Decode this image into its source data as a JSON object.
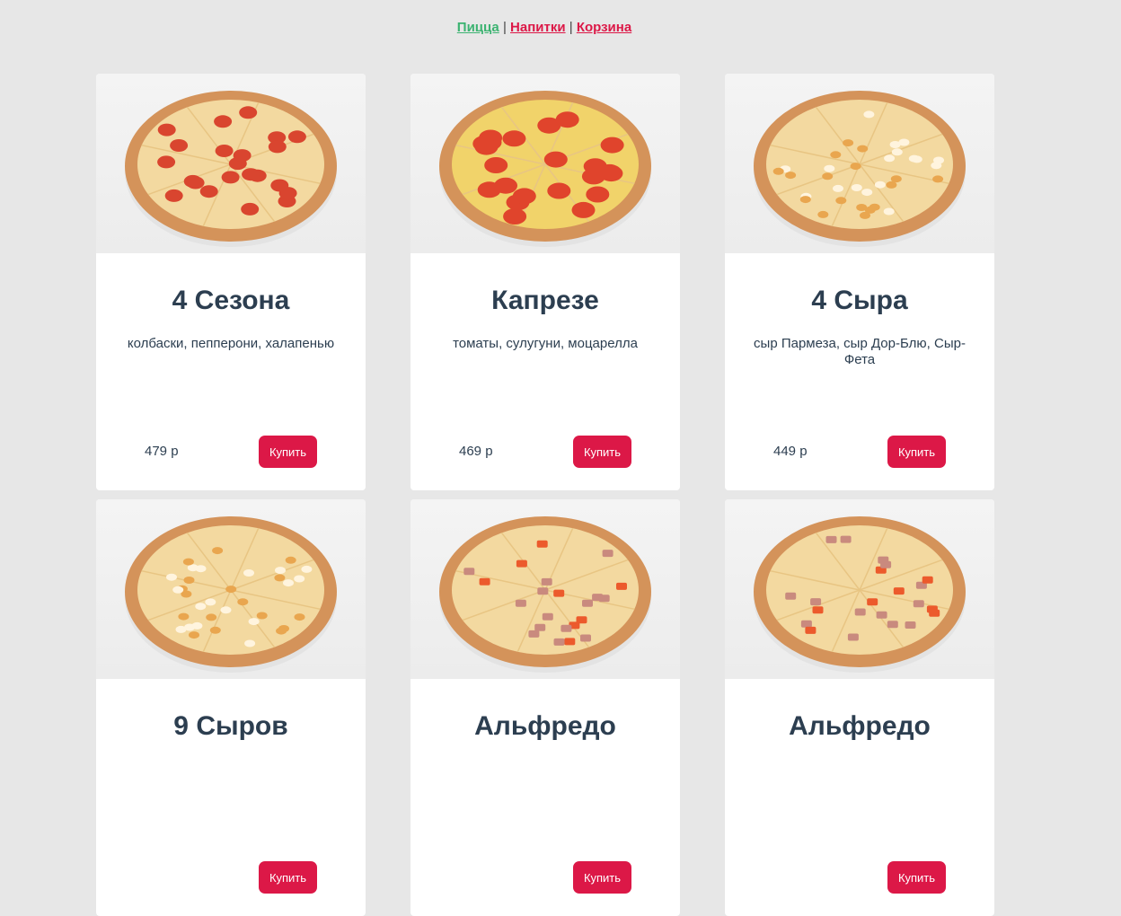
{
  "nav": {
    "pizza": "Пицца",
    "drinks": "Напитки",
    "cart": "Корзина",
    "separator": "|",
    "active_color": "#3cb371",
    "link_color": "#dc1847"
  },
  "buy_label": "Купить",
  "products": [
    {
      "title": "4 Сезона",
      "description": "колбаски, пепперони, халапенью",
      "price": "479 р",
      "image_icon": "pizza-four-seasons-image",
      "toppings": "pepperoni"
    },
    {
      "title": "Капрезе",
      "description": "томаты, сулугуни, моцарелла",
      "price": "469 р",
      "image_icon": "pizza-caprese-image",
      "toppings": "tomato"
    },
    {
      "title": "4 Сыра",
      "description": "сыр Пармеза, сыр Дор-Блю, Сыр-Фета",
      "price": "449 р",
      "image_icon": "pizza-four-cheese-image",
      "toppings": "cheese"
    },
    {
      "title": "9 Сыров",
      "description": "",
      "price": "",
      "image_icon": "pizza-nine-cheese-image",
      "toppings": "cheese"
    },
    {
      "title": "Альфредо",
      "description": "",
      "price": "",
      "image_icon": "pizza-alfredo-image",
      "toppings": "bacon"
    },
    {
      "title": "Альфредо",
      "description": "",
      "price": "",
      "image_icon": "pizza-alfredo-image",
      "toppings": "bacon"
    }
  ]
}
